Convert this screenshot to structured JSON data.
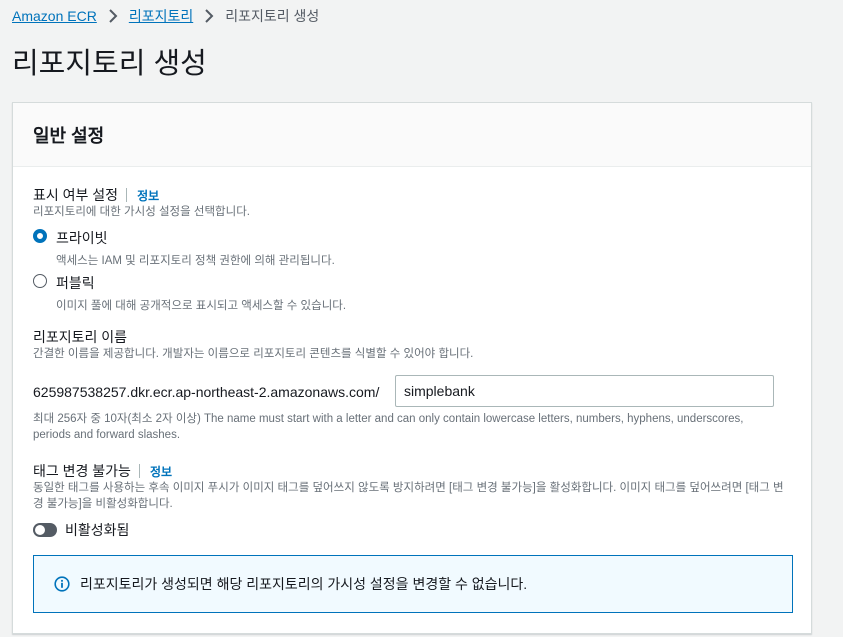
{
  "breadcrumb": {
    "items": [
      "Amazon ECR",
      "리포지토리"
    ],
    "current": "리포지토리 생성"
  },
  "page": {
    "title": "리포지토리 생성"
  },
  "general": {
    "title": "일반 설정",
    "visibility": {
      "label": "표시 여부 설정",
      "info": "정보",
      "description": "리포지토리에 대한 가시성 설정을 선택합니다.",
      "options": [
        {
          "label": "프라이빗",
          "description": "액세스는 IAM 및 리포지토리 정책 권한에 의해 관리됩니다.",
          "selected": true
        },
        {
          "label": "퍼블릭",
          "description": "이미지 풀에 대해 공개적으로 표시되고 액세스할 수 있습니다.",
          "selected": false
        }
      ]
    },
    "repo_name": {
      "label": "리포지토리 이름",
      "description": "간결한 이름을 제공합니다. 개발자는 이름으로 리포지토리 콘텐츠를 식별할 수 있어야 합니다.",
      "prefix": "625987538257.dkr.ecr.ap-northeast-2.amazonaws.com/",
      "value": "simplebank",
      "constraint": "최대 256자 중 10자(최소 2자 이상) The name must start with a letter and can only contain lowercase letters, numbers, hyphens, underscores, periods and forward slashes."
    },
    "tag_immutability": {
      "label": "태그 변경 불가능",
      "info": "정보",
      "description": "동일한 태그를 사용하는 후속 이미지 푸시가 이미지 태그를 덮어쓰지 않도록 방지하려면 [태그 변경 불가능]을 활성화합니다. 이미지 태그를 덮어쓰려면 [태그 변경 불가능]을 비활성화합니다.",
      "toggle_label": "비활성화됨",
      "enabled": false
    },
    "alert": {
      "text": "리포지토리가 생성되면 해당 리포지토리의 가시성 설정을 변경할 수 없습니다.",
      "color": "#0073bb"
    }
  },
  "colors": {
    "link": "#0073bb",
    "text": "#16191f",
    "muted": "#687078",
    "background": "#f2f3f3"
  },
  "icons": {
    "separator": "chevron-right-icon",
    "alert": "info-circle-icon"
  }
}
